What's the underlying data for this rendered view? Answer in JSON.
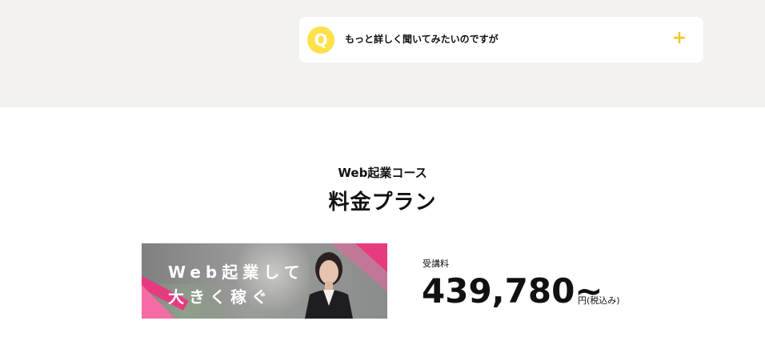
{
  "faq": {
    "badge": "Q",
    "question": "もっと詳しく聞いてみたいのですが",
    "expand_symbol": "+"
  },
  "pricing": {
    "subtitle": "Web起業コース",
    "title": "料金プラン",
    "banner": {
      "line1": "Web起業して",
      "line2": "大きく稼ぐ"
    },
    "fee_label": "受講料",
    "fee_amount": "439,780~",
    "fee_unit": "円(税込み)"
  },
  "colors": {
    "accent_pink": "#f0468f",
    "accent_yellow": "#fce14b",
    "band_bg": "#f3f2ef"
  }
}
